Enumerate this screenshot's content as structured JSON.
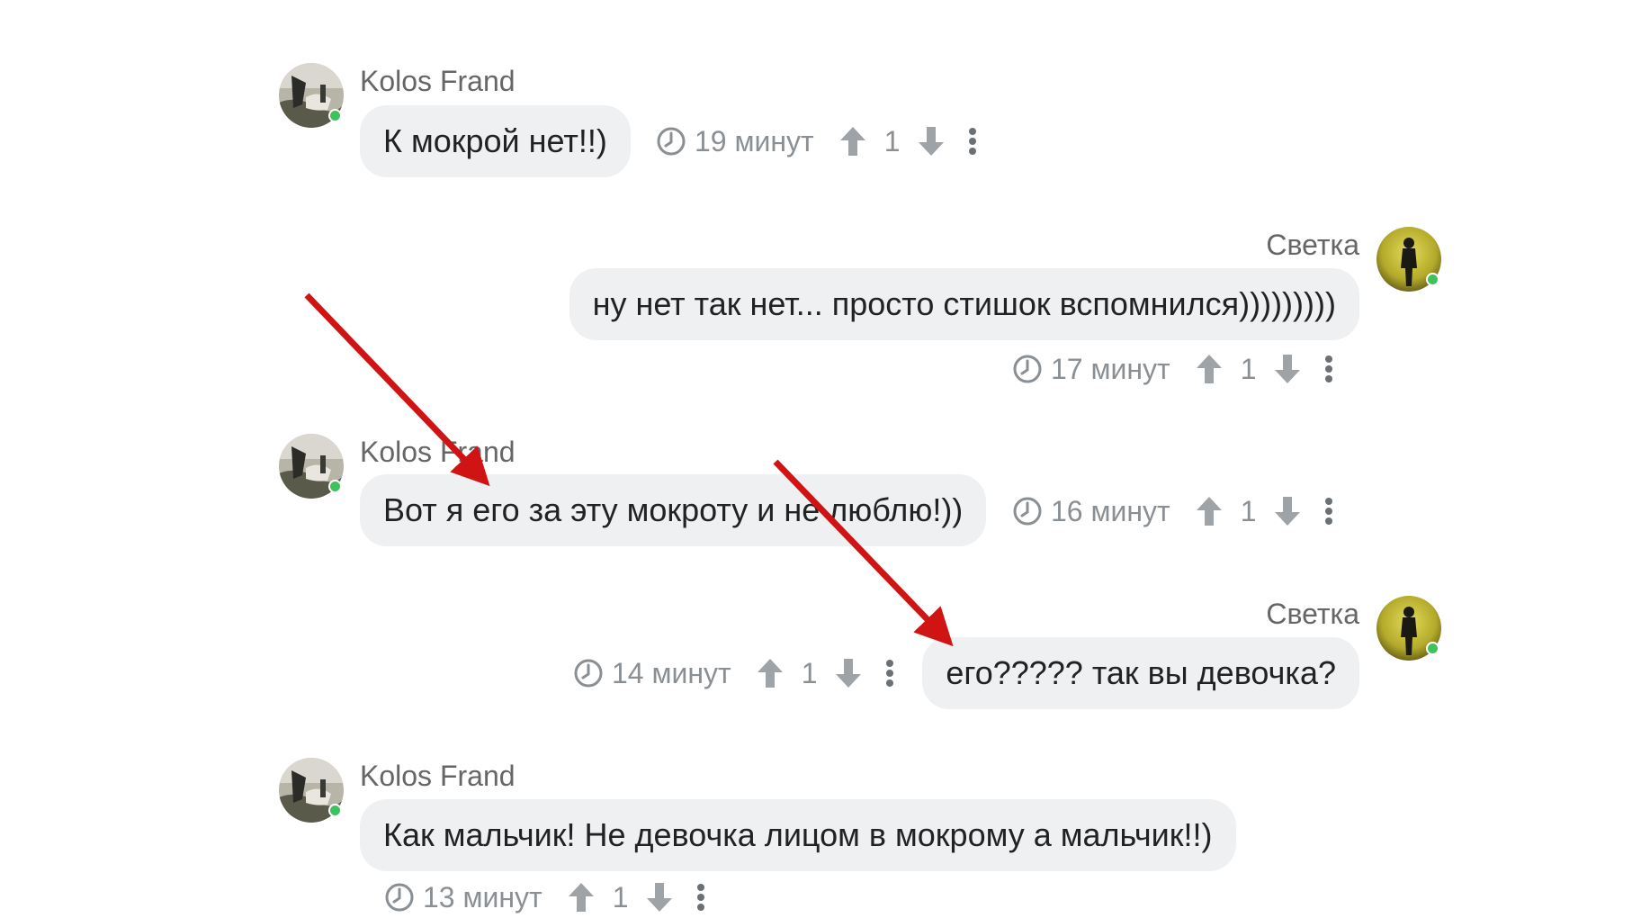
{
  "messages": [
    {
      "author": "Kolos Frand",
      "text": "К мокрой нет!!)",
      "time": "19 минут",
      "votes": "1"
    },
    {
      "author": "Светка",
      "text": "ну нет так нет... просто стишок вспомнился)))))))))",
      "time": "17 минут",
      "votes": "1"
    },
    {
      "author": "Kolos Frand",
      "text": "Вот я его за эту мокроту и не люблю!))",
      "time": "16 минут",
      "votes": "1"
    },
    {
      "author": "Светка",
      "text": "его????? так вы девочка?",
      "time": "14 минут",
      "votes": "1"
    },
    {
      "author": "Kolos Frand",
      "text": "Как мальчик! Не девочка лицом в мокрому а мальчик!!)",
      "time": "13 минут",
      "votes": "1"
    }
  ],
  "icons": {
    "clock": "clock-icon",
    "upvote": "arrow-up-icon",
    "downvote": "arrow-down-icon",
    "more": "more-vertical-icon"
  },
  "colors": {
    "bubble": "#eef0f2",
    "online": "#3cc35c",
    "annotation_arrow": "#d01414"
  }
}
